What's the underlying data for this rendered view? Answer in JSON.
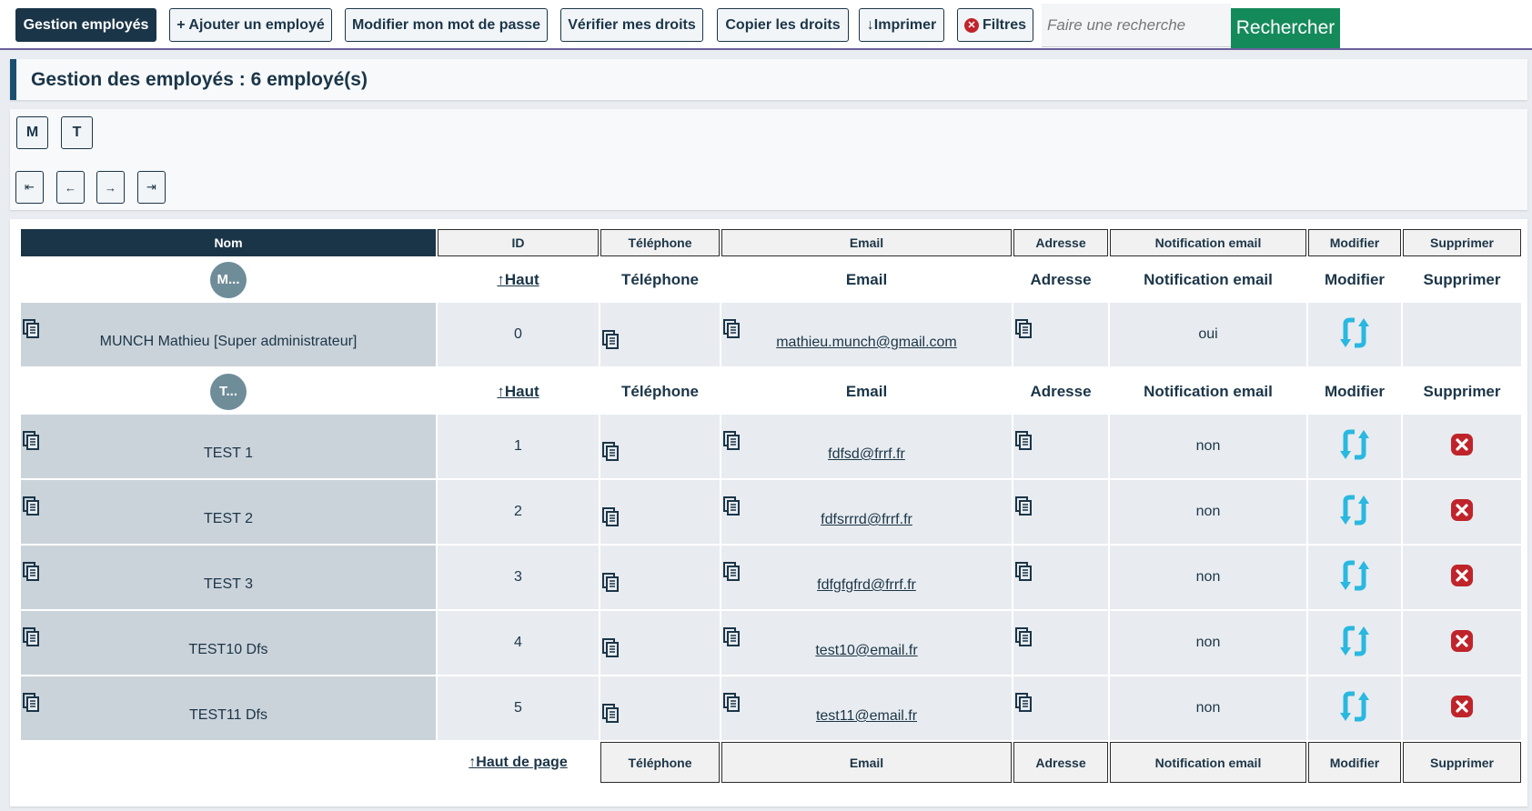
{
  "toolbar": {
    "gestion": "Gestion employés",
    "ajouter": "+ Ajouter un employé",
    "modifier_mdp": "Modifier mon mot de passe",
    "verifier": "Vérifier mes droits",
    "copier": "Copier les droits",
    "imprimer": "↓Imprimer",
    "filtres": "Filtres",
    "search_placeholder": "Faire une recherche",
    "search_button": "Rechercher"
  },
  "title": "Gestion des employés : 6 employé(s)",
  "letters": [
    "M",
    "T"
  ],
  "pager": {
    "first": "⇤",
    "prev": "←",
    "next": "→",
    "last": "⇥"
  },
  "columns": [
    "Nom",
    "ID",
    "Téléphone",
    "Email",
    "Adresse",
    "Notification email",
    "Modifier",
    "Supprimer"
  ],
  "groups": [
    {
      "avatar": "M...",
      "haut": "↑Haut",
      "subheaders": [
        "Téléphone",
        "Email",
        "Adresse",
        "Notification email",
        "Modifier",
        "Supprimer"
      ],
      "rows": [
        {
          "nom": "MUNCH Mathieu [Super administrateur]",
          "id": "0",
          "email": "mathieu.munch@gmail.com",
          "notification": "oui",
          "deletable": false
        }
      ]
    },
    {
      "avatar": "T...",
      "haut": "↑Haut",
      "subheaders": [
        "Téléphone",
        "Email",
        "Adresse",
        "Notification email",
        "Modifier",
        "Supprimer"
      ],
      "rows": [
        {
          "nom": "TEST 1",
          "id": "1",
          "email": "fdfsd@frrf.fr",
          "notification": "non",
          "deletable": true
        },
        {
          "nom": "TEST 2",
          "id": "2",
          "email": "fdfsrrrd@frrf.fr",
          "notification": "non",
          "deletable": true
        },
        {
          "nom": "TEST 3",
          "id": "3",
          "email": "fdfgfgfrd@frrf.fr",
          "notification": "non",
          "deletable": true
        },
        {
          "nom": "TEST10 Dfs",
          "id": "4",
          "email": "test10@email.fr",
          "notification": "non",
          "deletable": true
        },
        {
          "nom": "TEST11 Dfs",
          "id": "5",
          "email": "test11@email.fr",
          "notification": "non",
          "deletable": true
        }
      ]
    }
  ],
  "footer": {
    "haut_de_page": "↑Haut de page",
    "columns": [
      "Téléphone",
      "Email",
      "Adresse",
      "Notification email",
      "Modifier",
      "Supprimer"
    ]
  },
  "colors": {
    "primary": "#1b3548",
    "search_button": "#148a5a",
    "delete_icon": "#c0242b",
    "modify_icon": "#29b8e0",
    "avatar": "#6f8c99"
  }
}
